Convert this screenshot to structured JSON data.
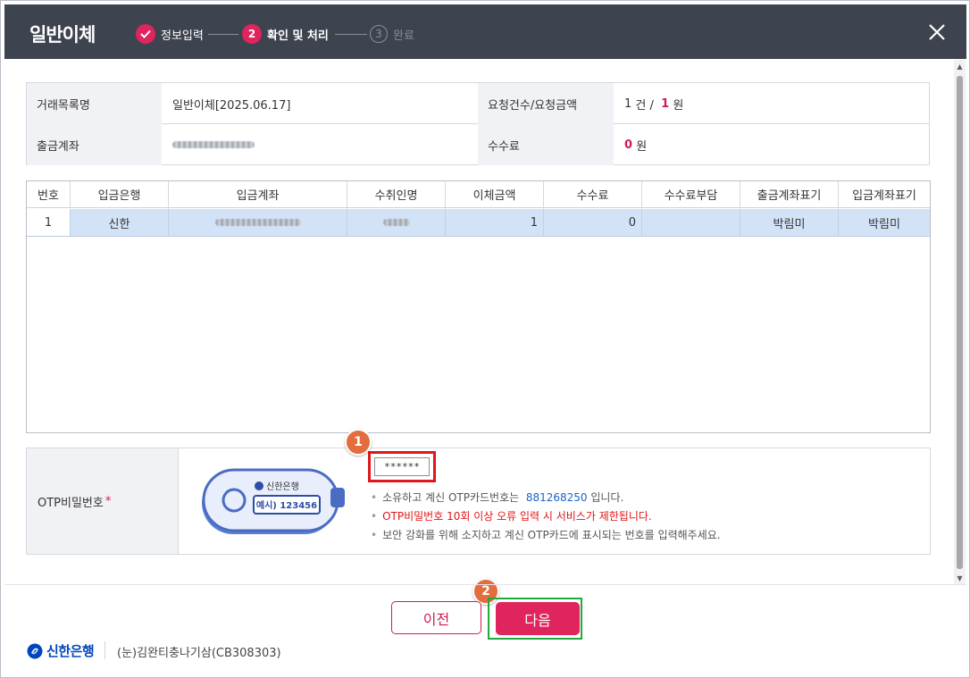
{
  "dialog": {
    "title": "일반이체",
    "steps": [
      {
        "num": "✓",
        "label": "정보입력",
        "state": "done"
      },
      {
        "num": "2",
        "label": "확인 및 처리",
        "state": "current"
      },
      {
        "num": "3",
        "label": "완료",
        "state": "todo"
      }
    ]
  },
  "info": {
    "trade_list_label": "거래목록명",
    "trade_list_value": "일반이체[2025.06.17]",
    "request_label": "요청건수/요청금액",
    "request_count": "1",
    "request_count_unit": "건 /",
    "request_amount": "1",
    "request_amount_unit": "원",
    "withdraw_label": "출금계좌",
    "fee_label": "수수료",
    "fee_value": "0",
    "fee_unit": "원"
  },
  "grid": {
    "columns": [
      "번호",
      "입금은행",
      "입금계좌",
      "수취인명",
      "이체금액",
      "수수료",
      "수수료부담",
      "출금계좌표기",
      "입금계좌표기"
    ],
    "rows": [
      {
        "no": "1",
        "bank": "신한",
        "amount": "1",
        "fee": "0",
        "fee_burden": "",
        "withdraw_memo": "박림미",
        "deposit_memo": "박림미"
      }
    ]
  },
  "otp": {
    "label": "OTP비밀번호",
    "required_mark": "*",
    "card_bank": "신한은행",
    "card_example": "예시) 123456",
    "input_value": "******",
    "note1_prefix": "소유하고 계신 OTP카드번호는",
    "note1_number": "881268250",
    "note1_suffix": "입니다.",
    "note2": "OTP비밀번호 10회 이상 오류 입력 시 서비스가 제한됩니다.",
    "note3": "보안 강화를 위해 소지하고 계신 OTP카드에 표시되는 번호를 입력해주세요."
  },
  "badges": {
    "b1": "1",
    "b2": "2"
  },
  "footer": {
    "prev_label": "이전",
    "next_label": "다음",
    "bank_name": "신한은행",
    "company": "(눈)김완티충나기삼(CB308303)"
  },
  "colors": {
    "header_bg": "#3e4350",
    "accent": "#e0245e",
    "highlight_row": "#d3e3f7",
    "annotation_red": "#e0161b",
    "annotation_green": "#22a93b",
    "badge": "#e36d3d"
  }
}
